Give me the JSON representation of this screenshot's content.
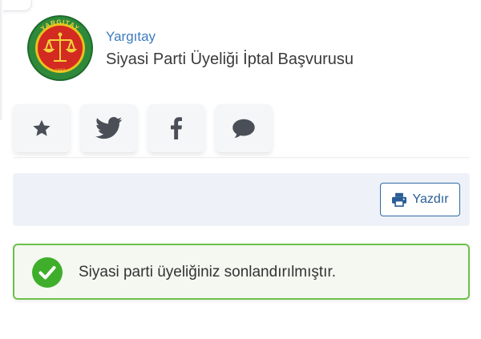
{
  "header": {
    "agency": "Yargıtay",
    "title": "Siyasi Parti Üyeliği İptal Başvurusu",
    "logo": {
      "arc_text": "YARGITAY",
      "year_text": "1868"
    }
  },
  "share_buttons": [
    {
      "icon": "star-icon"
    },
    {
      "icon": "twitter-icon"
    },
    {
      "icon": "facebook-icon"
    },
    {
      "icon": "comment-icon"
    }
  ],
  "toolbar": {
    "print_label": "Yazdır"
  },
  "alert": {
    "type": "success",
    "message": "Siyasi parti üyeliğiniz sonlandırılmıştır."
  },
  "colors": {
    "accent": "#3d7bbf",
    "print_border": "#2f6aa6",
    "success": "#3fae2a",
    "alert_border": "#6cc04a",
    "toolbar_bg": "#eef2f8"
  }
}
